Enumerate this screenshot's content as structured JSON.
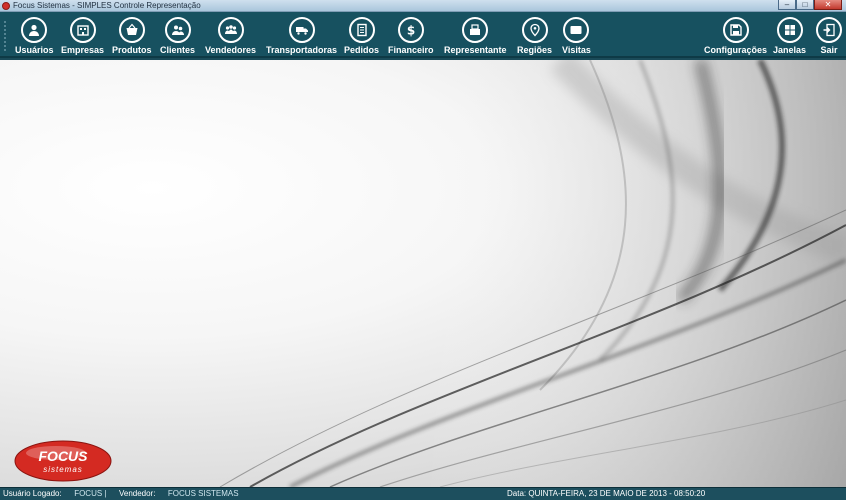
{
  "window": {
    "title": "Focus Sistemas - SIMPLES Controle Representação",
    "minimize_glyph": "–",
    "maximize_glyph": "□",
    "close_glyph": "✕"
  },
  "toolbar": {
    "items": [
      {
        "label": "Usuários",
        "icon": "user-icon"
      },
      {
        "label": "Empresas",
        "icon": "building-icon"
      },
      {
        "label": "Produtos",
        "icon": "basket-icon"
      },
      {
        "label": "Clientes",
        "icon": "people-icon"
      },
      {
        "label": "Vendedores",
        "icon": "group-icon"
      },
      {
        "label": "Transportadoras",
        "icon": "truck-icon"
      },
      {
        "label": "Pedidos",
        "icon": "document-icon"
      },
      {
        "label": "Financeiro",
        "icon": "dollar-icon"
      },
      {
        "label": "Representante",
        "icon": "register-icon"
      },
      {
        "label": "Regiões",
        "icon": "map-pin-icon"
      },
      {
        "label": "Visitas",
        "icon": "card-icon"
      }
    ],
    "right_items": [
      {
        "label": "Configurações",
        "icon": "save-icon"
      },
      {
        "label": "Janelas",
        "icon": "windows-icon"
      },
      {
        "label": "Sair",
        "icon": "exit-icon"
      }
    ]
  },
  "logo": {
    "text_top": "FOCUS",
    "text_bottom": "sistemas",
    "color": "#d42a22"
  },
  "statusbar": {
    "user_label": "Usuário Logado:",
    "user_value": "FOCUS |",
    "seller_label": "Vendedor:",
    "seller_value": "FOCUS SISTEMAS",
    "date_text": "Data: QUINTA-FEIRA, 23 DE MAIO DE 2013 - 08:50:20"
  },
  "colors": {
    "toolbar": "#175160",
    "statusbar": "#1d4f5e",
    "accent_red": "#d42a22"
  }
}
